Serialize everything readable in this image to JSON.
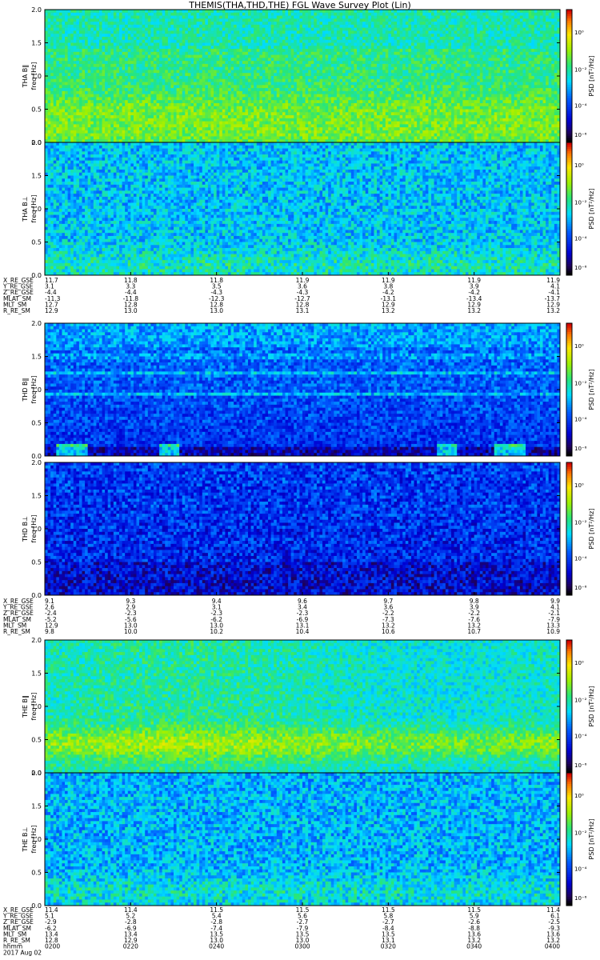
{
  "title": "THEMIS(THA,THD,THE) FGL Wave Survey Plot (Lin)",
  "chart_data": {
    "type": "heatmap",
    "y_axis": {
      "ylim": [
        0,
        2.0
      ],
      "ticks": [
        "0.0",
        "0.5",
        "1.0",
        "1.5",
        "2.0"
      ],
      "unit_label": "freq [Hz]"
    },
    "colorbar": {
      "label": "PSD [nT²/Hz]",
      "ticks": [
        "10⁰",
        "10⁻²",
        "10⁻⁴",
        "10⁻⁶"
      ],
      "colormap": "rainbow"
    },
    "panels": [
      {
        "name": "THA B‖",
        "axis_label": "THA B‖",
        "pattern": "tha-par"
      },
      {
        "name": "THA B⊥",
        "axis_label": "THA B⊥",
        "pattern": "tha-perp"
      },
      {
        "name": "THD B‖",
        "axis_label": "THD B‖",
        "pattern": "thd-par"
      },
      {
        "name": "THD B⊥",
        "axis_label": "THD B⊥",
        "pattern": "thd-perp"
      },
      {
        "name": "THE B‖",
        "axis_label": "THE B‖",
        "pattern": "the-par"
      },
      {
        "name": "THE B⊥",
        "axis_label": "THE B⊥",
        "pattern": "the-perp"
      }
    ],
    "ephemeris_labels": [
      "X_RE_GSE",
      "Y_RE_GSE",
      "Z_RE_GSE",
      "MLAT_SM",
      "MLT_SM",
      "R_RE_SM"
    ],
    "ephemeris": [
      {
        "probe": "THA",
        "rows": [
          [
            "11.7",
            "11.8",
            "11.8",
            "11.9",
            "11.9",
            "11.9",
            "11.9"
          ],
          [
            "3.1",
            "3.3",
            "3.5",
            "3.6",
            "3.8",
            "3.9",
            "4.1"
          ],
          [
            "-4.4",
            "-4.4",
            "-4.3",
            "-4.3",
            "-4.2",
            "-4.2",
            "-4.1"
          ],
          [
            "-11.3",
            "-11.8",
            "-12.3",
            "-12.7",
            "-13.1",
            "-13.4",
            "-13.7"
          ],
          [
            "12.7",
            "12.8",
            "12.8",
            "12.8",
            "12.9",
            "12.9",
            "12.9"
          ],
          [
            "12.9",
            "13.0",
            "13.0",
            "13.1",
            "13.2",
            "13.2",
            "13.2"
          ]
        ]
      },
      {
        "probe": "THD",
        "rows": [
          [
            "9.1",
            "9.3",
            "9.4",
            "9.6",
            "9.7",
            "9.8",
            "9.9"
          ],
          [
            "2.6",
            "2.9",
            "3.1",
            "3.4",
            "3.6",
            "3.9",
            "4.1"
          ],
          [
            "-2.4",
            "-2.3",
            "-2.3",
            "-2.3",
            "-2.2",
            "-2.2",
            "-2.1"
          ],
          [
            "-5.2",
            "-5.6",
            "-6.2",
            "-6.9",
            "-7.3",
            "-7.6",
            "-7.9"
          ],
          [
            "12.9",
            "13.0",
            "13.0",
            "13.1",
            "13.2",
            "13.2",
            "13.3"
          ],
          [
            "9.8",
            "10.0",
            "10.2",
            "10.4",
            "10.6",
            "10.7",
            "10.9"
          ]
        ]
      },
      {
        "probe": "THE",
        "rows": [
          [
            "11.4",
            "11.4",
            "11.5",
            "11.5",
            "11.5",
            "11.5",
            "11.4"
          ],
          [
            "5.1",
            "5.2",
            "5.4",
            "5.6",
            "5.8",
            "5.9",
            "6.1"
          ],
          [
            "-2.9",
            "-2.8",
            "-2.8",
            "-2.7",
            "-2.7",
            "-2.6",
            "-2.5"
          ],
          [
            "-6.2",
            "-6.9",
            "-7.4",
            "-7.9",
            "-8.4",
            "-8.8",
            "-9.3"
          ],
          [
            "13.4",
            "13.4",
            "13.5",
            "13.5",
            "13.5",
            "13.6",
            "13.6"
          ],
          [
            "12.8",
            "12.9",
            "13.0",
            "13.0",
            "13.1",
            "13.2",
            "13.2"
          ]
        ]
      }
    ],
    "time_axis": {
      "label": "hhmm",
      "ticks": [
        "0200",
        "0220",
        "0240",
        "0300",
        "0320",
        "0340",
        "0400"
      ]
    },
    "date_label": "2017 Aug 02"
  }
}
